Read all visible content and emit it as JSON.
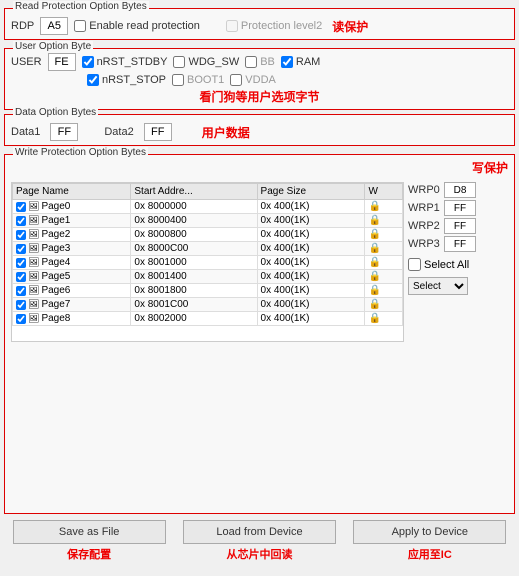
{
  "readProtection": {
    "title": "Read Protection Option Bytes",
    "chineseNote": "读保护",
    "rdpLabel": "RDP",
    "rdpValue": "A5",
    "enableCheckLabel": "Enable read protection",
    "enableChecked": false,
    "protectionLevel2Label": "Protection level2",
    "protectionLevel2Checked": false
  },
  "userOptionByte": {
    "title": "User Option Byte",
    "chineseNote": "看门狗等用户选项字节",
    "userLabel": "USER",
    "userValue": "FE",
    "checkboxes": [
      {
        "label": "nRST_STDBY",
        "checked": true
      },
      {
        "label": "WDG_SW",
        "checked": false
      },
      {
        "label": "BB",
        "checked": false
      },
      {
        "label": "RAM",
        "checked": true
      }
    ],
    "checkboxes2": [
      {
        "label": "nRST_STOP",
        "checked": true
      },
      {
        "label": "BOOT1",
        "checked": false
      },
      {
        "label": "VDDA",
        "checked": false
      }
    ]
  },
  "dataOptionBytes": {
    "title": "Data Option Bytes",
    "chineseNote": "用户数据",
    "data1Label": "Data1",
    "data1Value": "FF",
    "data2Label": "Data2",
    "data2Value": "FF"
  },
  "writeProtection": {
    "title": "Write Protection Option Bytes",
    "chineseNote": "写保护",
    "tableHeaders": [
      "Page Name",
      "Start Addre...",
      "Page Size",
      "W"
    ],
    "tableRows": [
      {
        "checked": true,
        "name": "Page0",
        "start": "0x 8000000",
        "size": "0x 400(1K)",
        "locked": true
      },
      {
        "checked": true,
        "name": "Page1",
        "start": "0x 8000400",
        "size": "0x 400(1K)",
        "locked": true
      },
      {
        "checked": true,
        "name": "Page2",
        "start": "0x 8000800",
        "size": "0x 400(1K)",
        "locked": true
      },
      {
        "checked": true,
        "name": "Page3",
        "start": "0x 8000C00",
        "size": "0x 400(1K)",
        "locked": true
      },
      {
        "checked": true,
        "name": "Page4",
        "start": "0x 8001000",
        "size": "0x 400(1K)",
        "locked": true
      },
      {
        "checked": true,
        "name": "Page5",
        "start": "0x 8001400",
        "size": "0x 400(1K)",
        "locked": true
      },
      {
        "checked": true,
        "name": "Page6",
        "start": "0x 8001800",
        "size": "0x 400(1K)",
        "locked": true
      },
      {
        "checked": true,
        "name": "Page7",
        "start": "0x 8001C00",
        "size": "0x 400(1K)",
        "locked": true
      },
      {
        "checked": true,
        "name": "Page8",
        "start": "0x 8002000",
        "size": "0x 400(1K)",
        "locked": true
      }
    ],
    "wrpLabels": [
      "WRP0",
      "WRP1",
      "WRP2",
      "WRP3"
    ],
    "wrpValues": [
      "D8",
      "FF",
      "FF",
      "FF"
    ],
    "selectAllLabel": "Select All",
    "selectLabel": "Select"
  },
  "buttons": {
    "saveAsFile": "Save as File",
    "saveAsFileChinese": "保存配置",
    "loadFromDevice": "Load from Device",
    "loadFromDeviceChinese": "从芯片中回读",
    "applyToDevice": "Apply to Device",
    "applyToDeviceChinese": "应用至IC"
  }
}
